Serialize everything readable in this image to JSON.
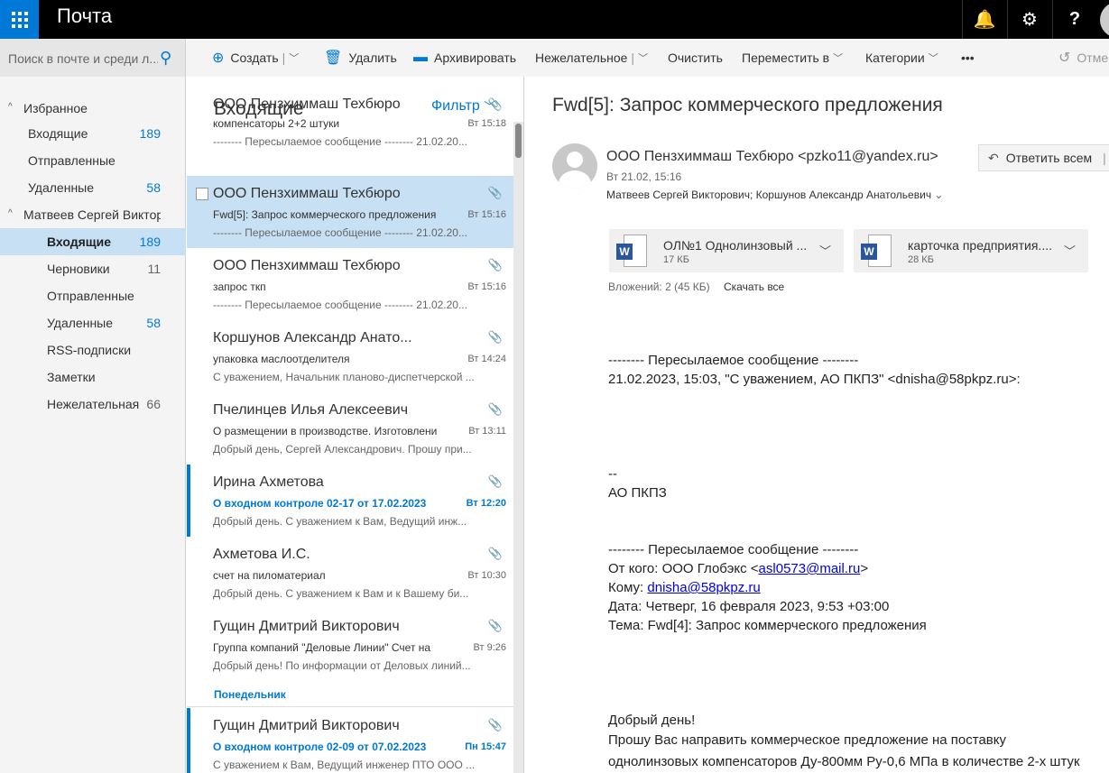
{
  "app": {
    "title": "Почта"
  },
  "topbar": {
    "bell": "🔔",
    "settings": "⚙",
    "help": "?"
  },
  "search": {
    "placeholder": "Поиск в почте и среди л..."
  },
  "toolbar": {
    "create": "Создать",
    "delete": "Удалить",
    "archive": "Архивировать",
    "junk": "Нежелательное",
    "sweep": "Очистить",
    "move": "Переместить в",
    "categories": "Категории",
    "more": "•••",
    "undo": "Отме"
  },
  "nav": {
    "favorites": "Избранное",
    "fav_inbox": "Входящие",
    "fav_inbox_count": "189",
    "fav_sent": "Отправленные",
    "fav_deleted": "Удаленные",
    "fav_deleted_count": "58",
    "account": "Матвеев Сергей Виктор",
    "inbox": "Входящие",
    "inbox_count": "189",
    "drafts": "Черновики",
    "drafts_count": "11",
    "sent": "Отправленные",
    "deleted": "Удаленные",
    "deleted_count": "58",
    "rss": "RSS-подписки",
    "notes": "Заметки",
    "junk": "Нежелательная",
    "junk_count": "66"
  },
  "list": {
    "title": "Входящие",
    "filter": "Фильтр",
    "group_monday": "Понедельник",
    "messages": [
      {
        "sender": "ООО Пензхиммаш Техбюро",
        "subject": "компенсаторы 2+2 штуки",
        "time": "Вт 15:18",
        "preview": "-------- Пересылаемое сообщение -------- 21.02.20..."
      },
      {
        "sender": "ООО Пензхиммаш Техбюро",
        "subject": "Fwd[5]: Запрос коммерческого предложения",
        "time": "Вт 15:16",
        "preview": "-------- Пересылаемое сообщение -------- 21.02.20..."
      },
      {
        "sender": "ООО Пензхиммаш Техбюро",
        "subject": "запрос ткп",
        "time": "Вт 15:16",
        "preview": "-------- Пересылаемое сообщение -------- 21.02.20..."
      },
      {
        "sender": "Коршунов Александр Анато...",
        "subject": "упаковка маслоотделителя",
        "time": "Вт 14:24",
        "preview": "С уважением, Начальник планово-диспетчерской ..."
      },
      {
        "sender": "Пчелинцев Илья Алексеевич",
        "subject": "О размещении в производстве. Изготовлени",
        "time": "Вт 13:11",
        "preview": "Добрый день, Сергей Александрович.  Прошу при..."
      },
      {
        "sender": "Ирина Ахметова",
        "subject": "О входном контроле 02-17 от 17.02.2023",
        "time": "Вт 12:20",
        "preview": "Добрый день.    С уважением к Вам, Ведущий инж..."
      },
      {
        "sender": "Ахметова И.С.",
        "subject": "счет на пиломатериал",
        "time": "Вт 10:30",
        "preview": "Добрый день.  С уважением к Вам и к Вашему би..."
      },
      {
        "sender": "Гущин Дмитрий Викторович",
        "subject": "Группа компаний \"Деловые Линии\" Счет на",
        "time": "Вт 9:26",
        "preview": "Добрый день!  По информации от Деловых линий..."
      },
      {
        "sender": "Гущин Дмитрий Викторович",
        "subject": "О входном контроле 02-09 от 07.02.2023",
        "time": "Пн 15:47",
        "preview": "С уважением к Вам, Ведущий инженер ПТО ООО ..."
      }
    ]
  },
  "reading": {
    "subject": "Fwd[5]: Запрос коммерческого предложения",
    "from": "ООО Пензхиммаш Техбюро <pzko11@yandex.ru>",
    "date": "Вт 21.02, 15:16",
    "to": "Матвеев Сергей Викторович; Коршунов Александр Анатольевич",
    "reply_all": "Ответить всем",
    "attachments": [
      {
        "name": "ОЛ№1 Однолинзовый ...",
        "size": "17 КБ"
      },
      {
        "name": "карточка предприятия....",
        "size": "28 КБ"
      }
    ],
    "attach_info": "Вложений: 2 (45 КБ)",
    "download_all": "Скачать все",
    "body": {
      "fwd1": "-------- Пересылаемое сообщение --------",
      "line1": "21.02.2023, 15:03, \"С уважением, АО ПКПЗ\" <dnisha@58pkpz.ru>:",
      "dashes": "--",
      "org": "АО ПКПЗ",
      "fwd2": "-------- Пересылаемое сообщение --------",
      "from_label": "От кого: ООО Глобэкс <",
      "from_email": "asl0573@mail.ru",
      "from_close": ">",
      "to_label": "Кому: ",
      "to_email": "dnisha@58pkpz.ru",
      "date_line": "Дата: Четверг, 16 февраля 2023, 9:53 +03:00",
      "subject_line": "Тема: Fwd[4]: Запрос коммерческого предложения",
      "greeting": "Добрый день!",
      "p1": "Прошу Вас направить коммерческое предложение на поставку",
      "p2": "однолинзовых компенсаторов Ду-800мм Ру-0,6 МПа в количестве 2-х штук"
    }
  }
}
